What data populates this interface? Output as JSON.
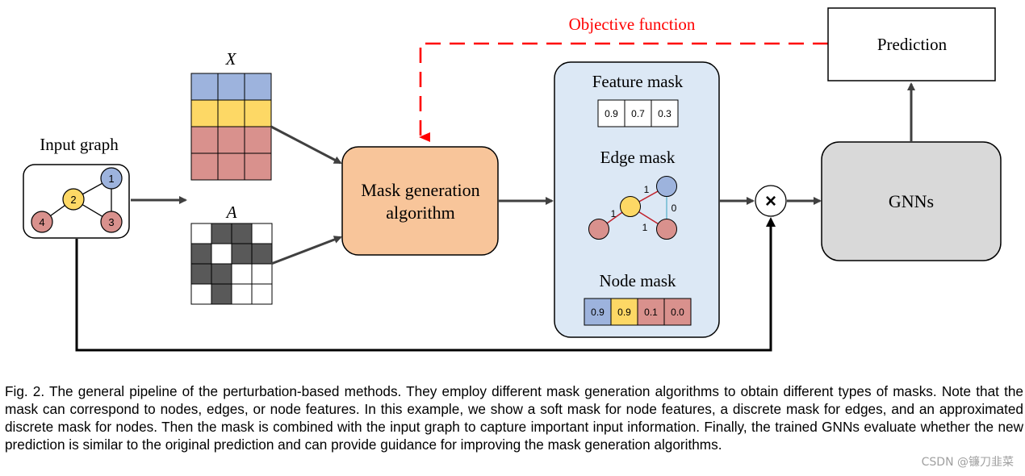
{
  "diagram": {
    "input_graph": {
      "label": "Input graph",
      "nodes": [
        {
          "id": "1",
          "color": "#9DB3DD"
        },
        {
          "id": "2",
          "color": "#FDD865"
        },
        {
          "id": "3",
          "color": "#D9918D"
        },
        {
          "id": "4",
          "color": "#D9918D"
        }
      ],
      "edges": [
        [
          "2",
          "1"
        ],
        [
          "1",
          "3"
        ],
        [
          "2",
          "3"
        ],
        [
          "2",
          "4"
        ]
      ]
    },
    "feature_matrix": {
      "label": "X",
      "row_colors": [
        "#9DB3DD",
        "#FDD865",
        "#D9918D",
        "#D9918D"
      ],
      "columns": 3
    },
    "adjacency_matrix": {
      "label": "A",
      "cells": [
        [
          0,
          1,
          1,
          0
        ],
        [
          1,
          0,
          1,
          1
        ],
        [
          1,
          1,
          0,
          0
        ],
        [
          0,
          1,
          0,
          0
        ]
      ],
      "filled_color": "#595959"
    },
    "mask_generator": {
      "line1": "Mask generation",
      "line2": "algorithm",
      "fill": "#F8C59A"
    },
    "objective": {
      "label": "Objective function",
      "color": "#FF0000"
    },
    "masks_panel": {
      "fill": "#DCE8F5",
      "feature_mask": {
        "title": "Feature mask",
        "values": [
          "0.9",
          "0.7",
          "0.3"
        ]
      },
      "edge_mask": {
        "title": "Edge mask",
        "edge_labels": {
          "e21": "1",
          "e24": "1",
          "e23": "1",
          "e13": "0"
        },
        "active_edge_color": "#C0202A",
        "inactive_edge_color": "#7FC1D8"
      },
      "node_mask": {
        "title": "Node mask",
        "values": [
          "0.9",
          "0.9",
          "0.1",
          "0.0"
        ],
        "colors": [
          "#9DB3DD",
          "#FDD865",
          "#D9918D",
          "#D9918D"
        ]
      }
    },
    "multiply_symbol": "×",
    "gnns": {
      "label": "GNNs",
      "fill": "#D9D9D9"
    },
    "prediction": {
      "label": "Prediction"
    }
  },
  "caption": "Fig. 2. The general pipeline of the perturbation-based methods. They employ different mask generation algorithms to obtain different types of masks. Note that the mask can correspond to nodes, edges, or node features. In this example, we show a soft mask for node features, a discrete mask for edges, and an approximated discrete mask for nodes. Then the mask is combined with the input graph to capture important input information. Finally, the trained GNNs evaluate whether the new prediction is similar to the original prediction and can provide guidance for improving the mask generation algorithms.",
  "watermark": "CSDN @镰刀韭菜"
}
